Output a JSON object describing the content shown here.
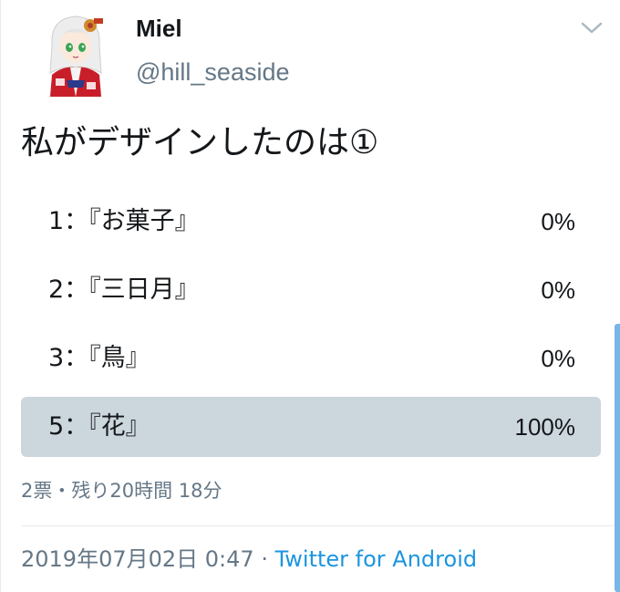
{
  "user": {
    "display_name": "Miel",
    "handle": "@hill_seaside"
  },
  "tweet": {
    "text": "私がデザインしたのは①"
  },
  "poll": {
    "options": [
      {
        "label": "1：『お菓子』",
        "percent_text": "0%",
        "percent": 0,
        "selected": false
      },
      {
        "label": "2：『三日月』",
        "percent_text": "0%",
        "percent": 0,
        "selected": false
      },
      {
        "label": "3：『鳥』",
        "percent_text": "0%",
        "percent": 0,
        "selected": false
      },
      {
        "label": "5：『花』",
        "percent_text": "100%",
        "percent": 100,
        "selected": true
      }
    ],
    "meta": "2票・残り20時間 18分"
  },
  "footer": {
    "timestamp": "2019年07月02日 0:47",
    "separator": "·",
    "source": "Twitter for Android"
  },
  "icons": {
    "menu": "chevron-down-icon",
    "avatar": "avatar"
  },
  "colors": {
    "poll_fill": "#ccd6dd",
    "secondary_text": "#657786",
    "link": "#1b95e0",
    "scrollbar": "#78b6e8"
  }
}
